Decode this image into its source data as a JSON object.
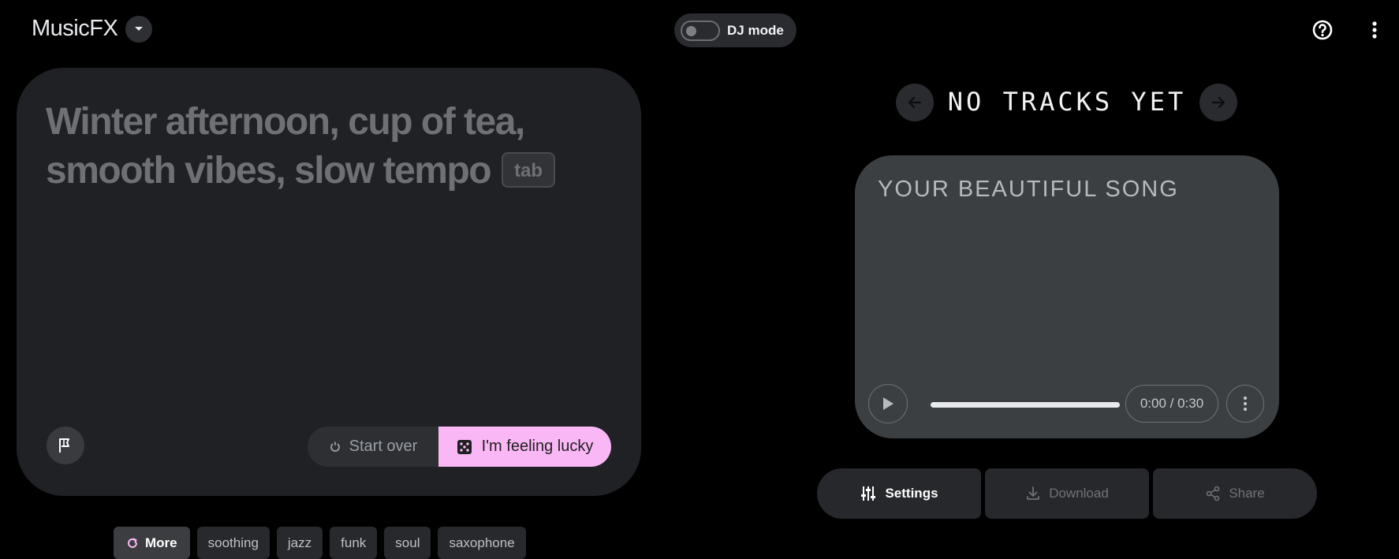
{
  "header": {
    "brand": "MusicFX",
    "dj_mode_label": "DJ mode"
  },
  "prompt": {
    "placeholder_text": "Winter afternoon, cup of tea, smooth vibes, slow tempo",
    "tab_hint": "tab",
    "start_over_label": "Start over",
    "lucky_label": "I'm feeling lucky"
  },
  "chips": {
    "more_label": "More",
    "items": [
      "soothing",
      "jazz",
      "funk",
      "soul",
      "saxophone"
    ]
  },
  "player": {
    "tracks_title": "NO TRACKS YET",
    "song_title": "YOUR BEAUTIFUL SONG",
    "time": "0:00 / 0:30"
  },
  "actions": {
    "settings_label": "Settings",
    "download_label": "Download",
    "share_label": "Share"
  },
  "colors": {
    "accent": "#f9b7f5",
    "background": "#000000",
    "card": "#202124",
    "song_card": "#3c3f42"
  }
}
